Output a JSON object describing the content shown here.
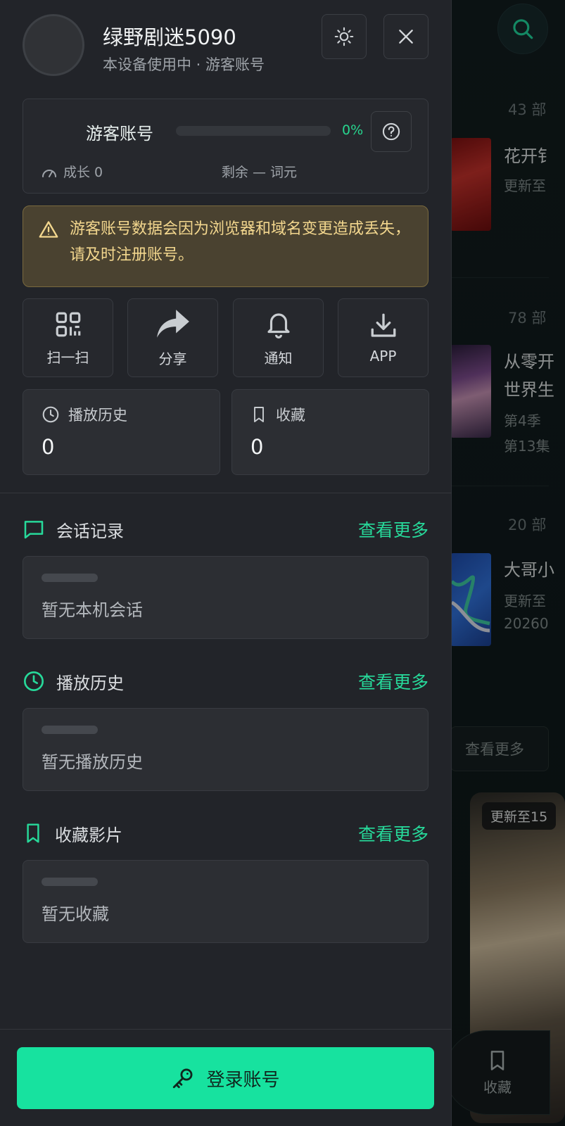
{
  "background": {
    "search_icon": "search-icon",
    "items": [
      {
        "count": "43 部",
        "title": "花开钅",
        "sub1": "更新至",
        "sub2": ""
      },
      {
        "count": "78 部",
        "title": "从零开",
        "title2": "世界生",
        "sub1": "第4季",
        "sub2": "第13集"
      },
      {
        "count": "20 部",
        "title": "大哥小",
        "sub1": "更新至",
        "sub2": "20260"
      }
    ],
    "more_button": "查看更多",
    "poster_tag": "更新至15",
    "fav_label": "收藏"
  },
  "profile": {
    "username": "绿野剧迷5090",
    "status": "本设备使用中 · 游客账号"
  },
  "level": {
    "title": "游客账号",
    "percent_text": "0%",
    "percent_value": 0,
    "growth": "成长 0",
    "remaining": "剩余 — 词元"
  },
  "warning": {
    "text": "游客账号数据会因为浏览器和域名变更造成丢失，请及时注册账号。"
  },
  "tiles": [
    {
      "label": "扫一扫",
      "icon": "qr-scan-icon"
    },
    {
      "label": "分享",
      "icon": "share-icon"
    },
    {
      "label": "通知",
      "icon": "bell-icon"
    },
    {
      "label": "APP",
      "icon": "download-icon"
    }
  ],
  "stats": {
    "history": {
      "label": "播放历史",
      "value": "0"
    },
    "favorites": {
      "label": "收藏",
      "value": "0"
    }
  },
  "sections": {
    "chat": {
      "title": "会话记录",
      "more": "查看更多",
      "empty": "暂无本机会话"
    },
    "history": {
      "title": "播放历史",
      "more": "查看更多",
      "empty": "暂无播放历史"
    },
    "favorites": {
      "title": "收藏影片",
      "more": "查看更多",
      "empty": "暂无收藏"
    }
  },
  "login": {
    "label": "登录账号"
  },
  "colors": {
    "accent": "#17e29f",
    "drawer_bg": "#222429",
    "warning_bg": "#4a4230",
    "warning_text": "#f3d78e"
  }
}
